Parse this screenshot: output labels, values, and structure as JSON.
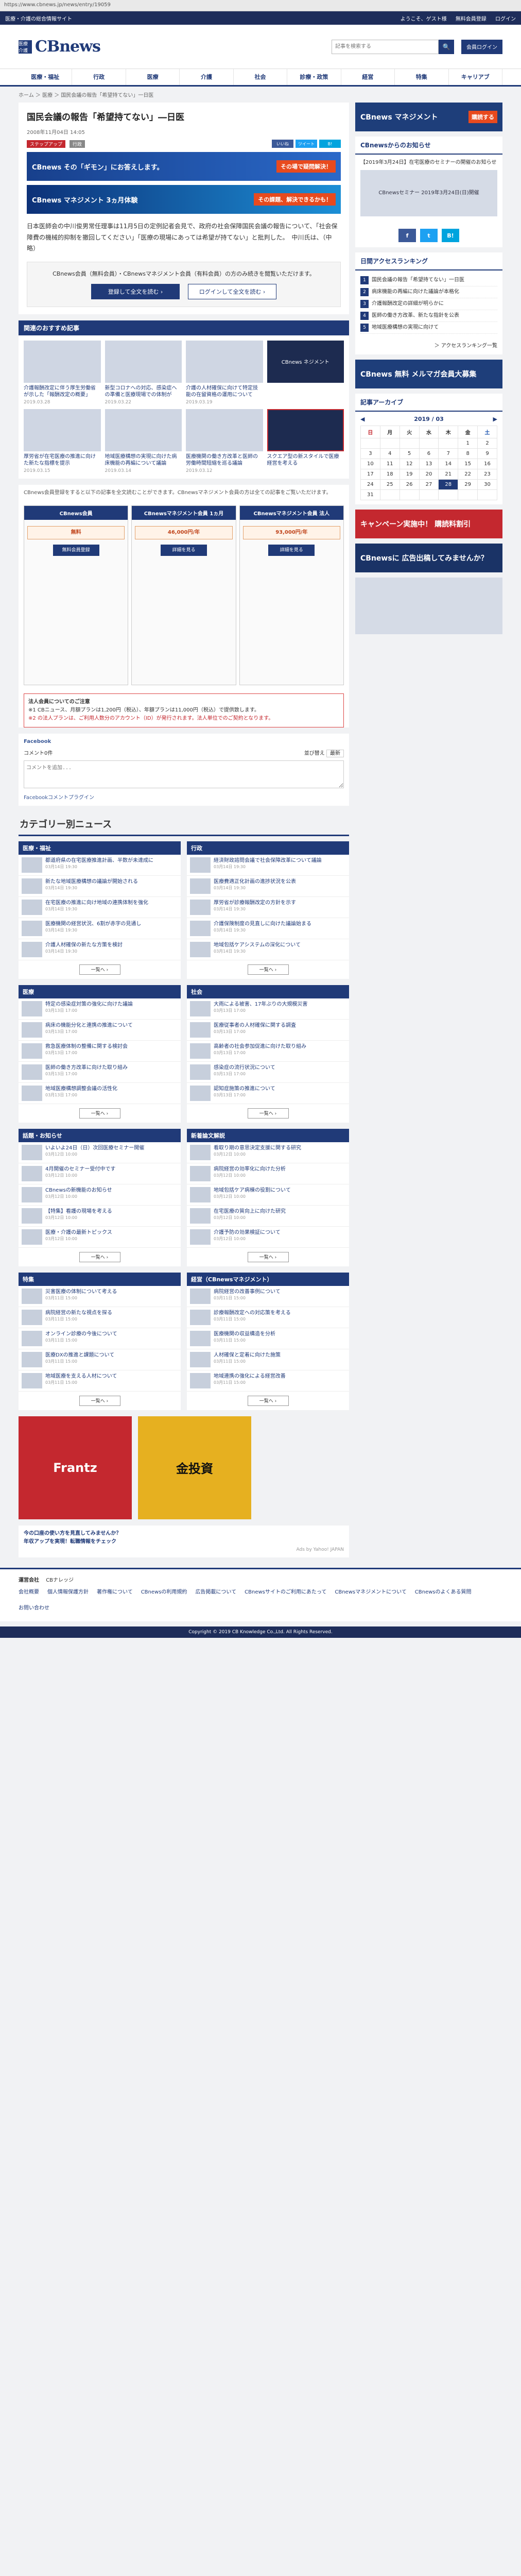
{
  "browser": {
    "url": "https://www.cbnews.jp/news/entry/19059"
  },
  "topbar": {
    "left": "医療・介護の総合情報サイト",
    "links": [
      "ようこそ、ゲスト様",
      "無料会員登録",
      "ログイン"
    ]
  },
  "header": {
    "logo": "CBnews",
    "logo_badge": "医療介護",
    "search_placeholder": "記事を検索する",
    "login_label": "会員ログイン"
  },
  "nav": [
    "医療・福祉",
    "行政",
    "医療",
    "介護",
    "社会",
    "診療・政策",
    "経営",
    "特集",
    "キャリアブ"
  ],
  "breadcrumb": "ホーム ＞ 医療 ＞ 国民会議の報告「希望持てない」一日医",
  "article": {
    "title": "国民会議の報告「希望持てない」―日医",
    "date": "2008年11月04日 14:05",
    "tags": [
      "ステップアップ",
      "行政"
    ],
    "category": "在宅医療",
    "share": [
      "いいね",
      "ツイート",
      "B!"
    ],
    "banner_text": "CBnews その「ギモン」にお答えします。",
    "banner_pill": "その場で疑問解決！",
    "banner2_text": "CBnews マネジメント 3ヵ月体験",
    "banner2_sub": "その課題、解決できるかも！",
    "body": "日本医師会の中川俊男常任理事は11月5日の定例記者会見で、政府の社会保障国民会議の報告について、「社会保障費の機械的抑制を撤回してください」「医療の現場にあっては希望が持てない」と批判した。　中川氏は、（中略）",
    "login_text": "CBnews会員（無料会員）・CBnewsマネジメント会員（有料会員）の方のみ続きを閲覧いただけます。",
    "register_label": "登録して全文を読む ›",
    "login_label": "ログインして全文を読む ›"
  },
  "recommend": {
    "title": "関連のおすすめ記事",
    "items": [
      {
        "caption": "介護報酬改定に伴う厚生労働省が示した「報酬改定の概要」",
        "date": "2019.03.28"
      },
      {
        "caption": "新型コロナへの対応、感染症への準備と医療現場での体制が",
        "date": "2019.03.22"
      },
      {
        "caption": "介護の人材確保に向けて特定技能の在留資格の運用について",
        "date": "2019.03.19"
      },
      {
        "caption": "CBnews ネジメント",
        "date": ""
      },
      {
        "caption": "厚労省が在宅医療の推進に向けた新たな指標を提示",
        "date": "2019.03.15"
      },
      {
        "caption": "地域医療構想の実現に向けた病床機能の再編について議論",
        "date": "2019.03.14"
      },
      {
        "caption": "医療機関の働き方改革と医師の労働時間短縮を巡る議論",
        "date": "2019.03.12"
      },
      {
        "caption": "スクエア型の新スタイルで医療経営を考える",
        "date": ""
      }
    ]
  },
  "plans": {
    "notice": "CBnews会員登録をすると以下の記事を全文読むことができます。CBnewsマネジメント会員の方は全ての記事をご覧いただけます。",
    "columns": [
      {
        "title": "CBnews会員",
        "price": "無料",
        "button": "無料会員登録"
      },
      {
        "title": "CBnewsマネジメント会員 1ヵ月",
        "price": "46,000円/年",
        "button": "詳細を見る"
      },
      {
        "title": "CBnewsマネジメント会員 法人",
        "price": "93,000円/年",
        "button": "詳細を見る"
      }
    ]
  },
  "footnote": {
    "title": "法人会員についてのご注意",
    "text": "※1 CBニュース、月額プランは1,200円（税込）、年額プランは11,000円（税込）で提供致します。",
    "red": "※2 の法人プランは、ご利用人数分のアカウント（ID）が発行されます。法人単位でのご契約となります。"
  },
  "facebook": {
    "label": "Facebook",
    "count": "コメント0件",
    "sort_label": "並び替え",
    "sort_value": "最新",
    "placeholder": "コメントを追加...",
    "plugin": "Facebookコメントプラグイン"
  },
  "categories": {
    "title": "カテゴリー別ニュース",
    "boxes": [
      {
        "name": "医療・福祉",
        "rows": [
          "都道府県の在宅医療推進計画、半数が未達成に",
          "新たな地域医療構想の議論が開始される",
          "在宅医療の推進に向け地域の連携体制を強化",
          "医療機関の経営状況、6割が赤字の見通し",
          "介護人材確保の新たな方策を検討"
        ],
        "date": "03月14日 19:30"
      },
      {
        "name": "行政",
        "rows": [
          "経済財政諮問会議で社会保障改革について議論",
          "医療費適正化計画の進捗状況を公表",
          "厚労省が診療報酬改定の方針を示す",
          "介護保険制度の見直しに向けた議論始まる",
          "地域包括ケアシステムの深化について"
        ],
        "date": "03月14日 19:30"
      },
      {
        "name": "医療",
        "rows": [
          "特定の感染症対策の強化に向けた議論",
          "病床の機能分化と連携の推進について",
          "救急医療体制の整備に関する検討会",
          "医師の働き方改革に向けた取り組み",
          "地域医療構想調整会議の活性化"
        ],
        "date": "03月13日 17:00"
      },
      {
        "name": "社会",
        "rows": [
          "大雨による被害、17年ぶりの大規模災害",
          "医療従事者の人材確保に関する調査",
          "高齢者の社会参加促進に向けた取り組み",
          "感染症の流行状況について",
          "認知症施策の推進について"
        ],
        "date": "03月13日 17:00"
      },
      {
        "name": "話題・お知らせ",
        "rows": [
          "いよいよ24日（日）次回医療セミナー開催",
          "4月開催のセミナー受付中です",
          "CBnewsの新機能のお知らせ",
          "【特集】看護の現場を考える",
          "医療・介護の最新トピックス"
        ],
        "date": "03月12日 10:00"
      },
      {
        "name": "新着論文解説",
        "rows": [
          "看取り期の意思決定支援に関する研究",
          "病院経営の効率化に向けた分析",
          "地域包括ケア病棟の役割について",
          "在宅医療の質向上に向けた研究",
          "介護予防の効果検証について"
        ],
        "date": "03月12日 10:00"
      },
      {
        "name": "特集",
        "rows": [
          "災害医療の体制について考える",
          "病院経営の新たな視点を探る",
          "オンライン診療の今後について",
          "医療DXの推進と課題について",
          "地域医療を支える人材について"
        ],
        "date": "03月11日 15:00"
      },
      {
        "name": "経営（CBnewsマネジメント）",
        "rows": [
          "病院経営の改善事例について",
          "診療報酬改定への対応策を考える",
          "医療機関の収益構造を分析",
          "人材確保と定着に向けた施策",
          "地域連携の強化による経営改善"
        ],
        "date": "03月11日 15:00"
      }
    ],
    "more": "一覧へ ›"
  },
  "bottom_ads": {
    "left": "Frantz",
    "right": "金投資",
    "list_title": "Ads by Yahoo! JAPAN",
    "items": [
      "今の口座の使い方を見直してみませんか？",
      "年収アップを実現！転職情報をチェック"
    ]
  },
  "sidebar": {
    "ad1_title": "CBnews マネジメント",
    "ad1_cta": "購読する",
    "notice_title": "CBnewsからのお知らせ",
    "notice_text": "【2019年3月24日】在宅医療のセミナーの開催のお知らせ",
    "promo_text": "CBnewsセミナー 2019年3月24日(日)開催",
    "sns": [
      "f",
      "t",
      "B!"
    ],
    "ranking_title": "日間アクセスランキング",
    "ranking": [
      "国民会議の報告「希望持てない」一日医",
      "病床機能の再編に向けた議論が本格化",
      "介護報酬改定の詳細が明らかに",
      "医師の働き方改革、新たな指針を公表",
      "地域医療構想の実現に向けて"
    ],
    "ranking_more": "＞ アクセスランキング一覧",
    "ad2_title": "CBnews 無料 メルマガ会員大募集",
    "calendar_title": "記事アーカイブ",
    "calendar_month": "2019 / 03",
    "weekdays": [
      "日",
      "月",
      "火",
      "水",
      "木",
      "金",
      "土"
    ],
    "days": [
      "",
      "",
      "",
      "",
      "",
      "1",
      "2",
      "3",
      "4",
      "5",
      "6",
      "7",
      "8",
      "9",
      "10",
      "11",
      "12",
      "13",
      "14",
      "15",
      "16",
      "17",
      "18",
      "19",
      "20",
      "21",
      "22",
      "23",
      "24",
      "25",
      "26",
      "27",
      "28",
      "29",
      "30",
      "31",
      "",
      "",
      "",
      "",
      "",
      ""
    ],
    "ad3_title": "キャンペーン実施中！ 購読料割引",
    "ad4_title": "CBnewsに 広告出稿してみませんか？"
  },
  "footer": {
    "company": "運営会社",
    "company_name": "CBナレッジ",
    "links": [
      "会社概要",
      "個人情報保護方針",
      "著作権について",
      "CBnewsの利用規約",
      "広告掲載について",
      "CBnewsサイトのご利用にあたって",
      "CBnewsマネジメントについて",
      "CBnewsのよくある質問",
      "お問い合わせ"
    ],
    "copyright": "Copyright © 2019 CB Knowledge Co.,Ltd. All Rights Reserved."
  }
}
